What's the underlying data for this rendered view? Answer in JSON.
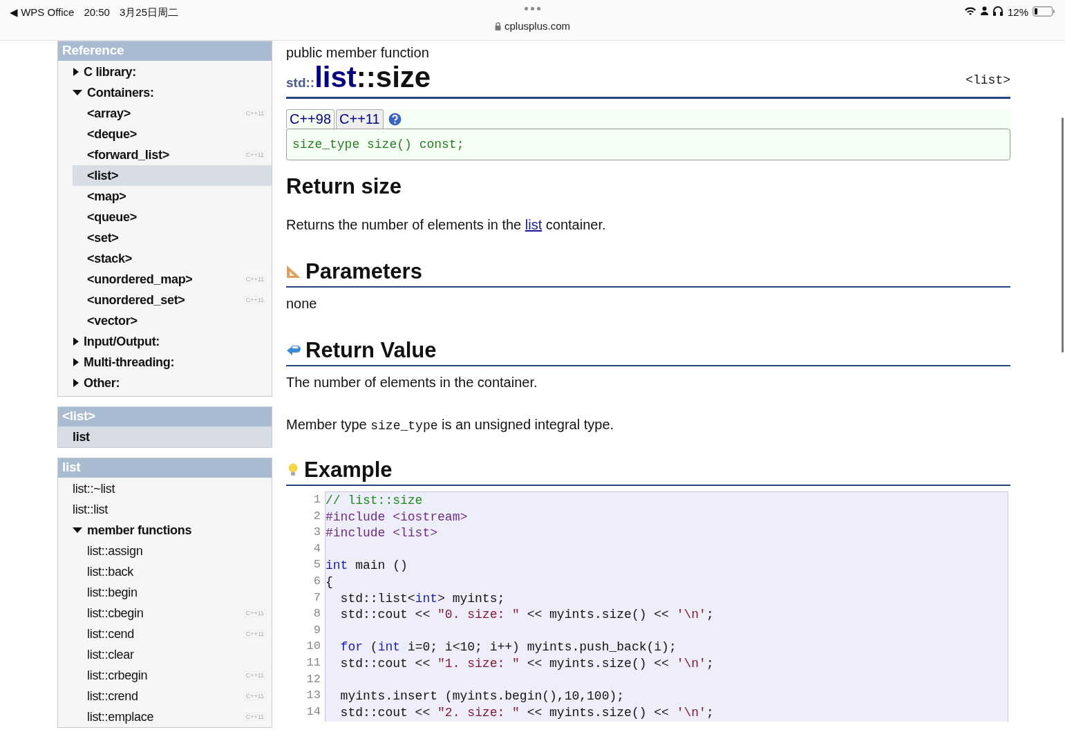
{
  "status_bar": {
    "back_glyph": "◀",
    "back_app": "WPS Office",
    "time": "20:50",
    "date": "3月25日周二",
    "url": "cplusplus.com",
    "battery_percent": "12%"
  },
  "sidebar": {
    "reference": {
      "title": "Reference",
      "items": [
        {
          "label": "C library:",
          "selected": false,
          "expanded": false
        },
        {
          "label": "Containers:",
          "selected": false,
          "expanded": true,
          "children": [
            {
              "label": "<array>",
              "selected": false,
              "tag": "C++11"
            },
            {
              "label": "<deque>",
              "selected": false
            },
            {
              "label": "<forward_list>",
              "selected": false,
              "tag": "C++11"
            },
            {
              "label": "<list>",
              "selected": true
            },
            {
              "label": "<map>",
              "selected": false
            },
            {
              "label": "<queue>",
              "selected": false
            },
            {
              "label": "<set>",
              "selected": false
            },
            {
              "label": "<stack>",
              "selected": false
            },
            {
              "label": "<unordered_map>",
              "selected": false,
              "tag": "C++11"
            },
            {
              "label": "<unordered_set>",
              "selected": false,
              "tag": "C++11"
            },
            {
              "label": "<vector>",
              "selected": false
            }
          ]
        },
        {
          "label": "Input/Output:",
          "selected": false,
          "expanded": false
        },
        {
          "label": "Multi-threading:",
          "selected": false,
          "expanded": false
        },
        {
          "label": "Other:",
          "selected": false,
          "expanded": false
        }
      ]
    },
    "header": {
      "title": "<list>",
      "items": [
        {
          "label": "list",
          "selected": true
        }
      ]
    },
    "members": {
      "title": "list",
      "items": [
        {
          "label": "list::~list",
          "selected": false
        },
        {
          "label": "list::list",
          "selected": false
        },
        {
          "label": "member functions",
          "selected": false,
          "expanded": true,
          "children": [
            {
              "label": "list::assign",
              "selected": false
            },
            {
              "label": "list::back",
              "selected": false
            },
            {
              "label": "list::begin",
              "selected": false
            },
            {
              "label": "list::cbegin",
              "selected": false,
              "tag": "C++11"
            },
            {
              "label": "list::cend",
              "selected": false,
              "tag": "C++11"
            },
            {
              "label": "list::clear",
              "selected": false
            },
            {
              "label": "list::crbegin",
              "selected": false,
              "tag": "C++11"
            },
            {
              "label": "list::crend",
              "selected": false,
              "tag": "C++11"
            },
            {
              "label": "list::emplace",
              "selected": false,
              "tag": "C++11"
            }
          ]
        }
      ]
    }
  },
  "main": {
    "kind_label": "public member function",
    "title": {
      "namespace": "std::",
      "class": "list",
      "member": "::size"
    },
    "header_ref": "<list>",
    "tabs": [
      {
        "label": "C++98",
        "selected": true
      },
      {
        "label": "C++11",
        "selected": false
      }
    ],
    "signature": "size_type size() const;",
    "description": {
      "heading": "Return size",
      "text": [
        {
          "kind": "text",
          "text": "Returns the number of elements in the "
        },
        {
          "kind": "link",
          "text": "list"
        },
        {
          "kind": "text",
          "text": " container."
        }
      ]
    },
    "parameters": {
      "heading": "Parameters",
      "text": "none"
    },
    "return_value": {
      "heading": "Return Value",
      "paragraphs": [
        [
          {
            "kind": "text",
            "text": "The number of elements in the container."
          }
        ],
        [
          {
            "kind": "text",
            "text": "Member type "
          },
          {
            "kind": "code",
            "text": "size_type"
          },
          {
            "kind": "text",
            "text": " is an unsigned integral type."
          }
        ]
      ]
    },
    "example": {
      "heading": "Example",
      "lines": [
        {
          "number": "1",
          "tokens": [
            {
              "kind": "comment",
              "text": "// list::size"
            }
          ]
        },
        {
          "number": "2",
          "tokens": [
            {
              "kind": "preproc",
              "text": "#include <iostream>"
            }
          ]
        },
        {
          "number": "3",
          "tokens": [
            {
              "kind": "preproc",
              "text": "#include <list>"
            }
          ]
        },
        {
          "number": "4"
        },
        {
          "number": "5",
          "tokens": [
            {
              "kind": "keyword",
              "text": "int"
            },
            {
              "kind": "plain",
              "text": " main ()"
            }
          ]
        },
        {
          "number": "6",
          "tokens": [
            {
              "kind": "plain",
              "text": "{"
            }
          ]
        },
        {
          "number": "7",
          "tokens": [
            {
              "kind": "plain",
              "text": "  std::list<"
            },
            {
              "kind": "keyword",
              "text": "int"
            },
            {
              "kind": "plain",
              "text": "> myints;"
            }
          ]
        },
        {
          "number": "8",
          "tokens": [
            {
              "kind": "plain",
              "text": "  std::cout << "
            },
            {
              "kind": "string",
              "text": "\"0. size: \""
            },
            {
              "kind": "plain",
              "text": " << myints.size() << "
            },
            {
              "kind": "string",
              "text": "'\\n'"
            },
            {
              "kind": "plain",
              "text": ";"
            }
          ]
        },
        {
          "number": "9"
        },
        {
          "number": "10",
          "tokens": [
            {
              "kind": "keyword",
              "text": "  for"
            },
            {
              "kind": "plain",
              "text": " ("
            },
            {
              "kind": "keyword",
              "text": "int"
            },
            {
              "kind": "plain",
              "text": " i=0; i<10; i++) myints.push_back(i);"
            }
          ]
        },
        {
          "number": "11",
          "tokens": [
            {
              "kind": "plain",
              "text": "  std::cout << "
            },
            {
              "kind": "string",
              "text": "\"1. size: \""
            },
            {
              "kind": "plain",
              "text": " << myints.size() << "
            },
            {
              "kind": "string",
              "text": "'\\n'"
            },
            {
              "kind": "plain",
              "text": ";"
            }
          ]
        },
        {
          "number": "12"
        },
        {
          "number": "13",
          "tokens": [
            {
              "kind": "plain",
              "text": "  myints.insert (myints.begin(),10,100);"
            }
          ]
        },
        {
          "number": "14",
          "tokens": [
            {
              "kind": "plain",
              "text": "  std::cout << "
            },
            {
              "kind": "string",
              "text": "\"2. size: \""
            },
            {
              "kind": "plain",
              "text": " << myints.size() << "
            },
            {
              "kind": "string",
              "text": "'\\n'"
            },
            {
              "kind": "plain",
              "text": ";"
            }
          ]
        }
      ]
    }
  }
}
